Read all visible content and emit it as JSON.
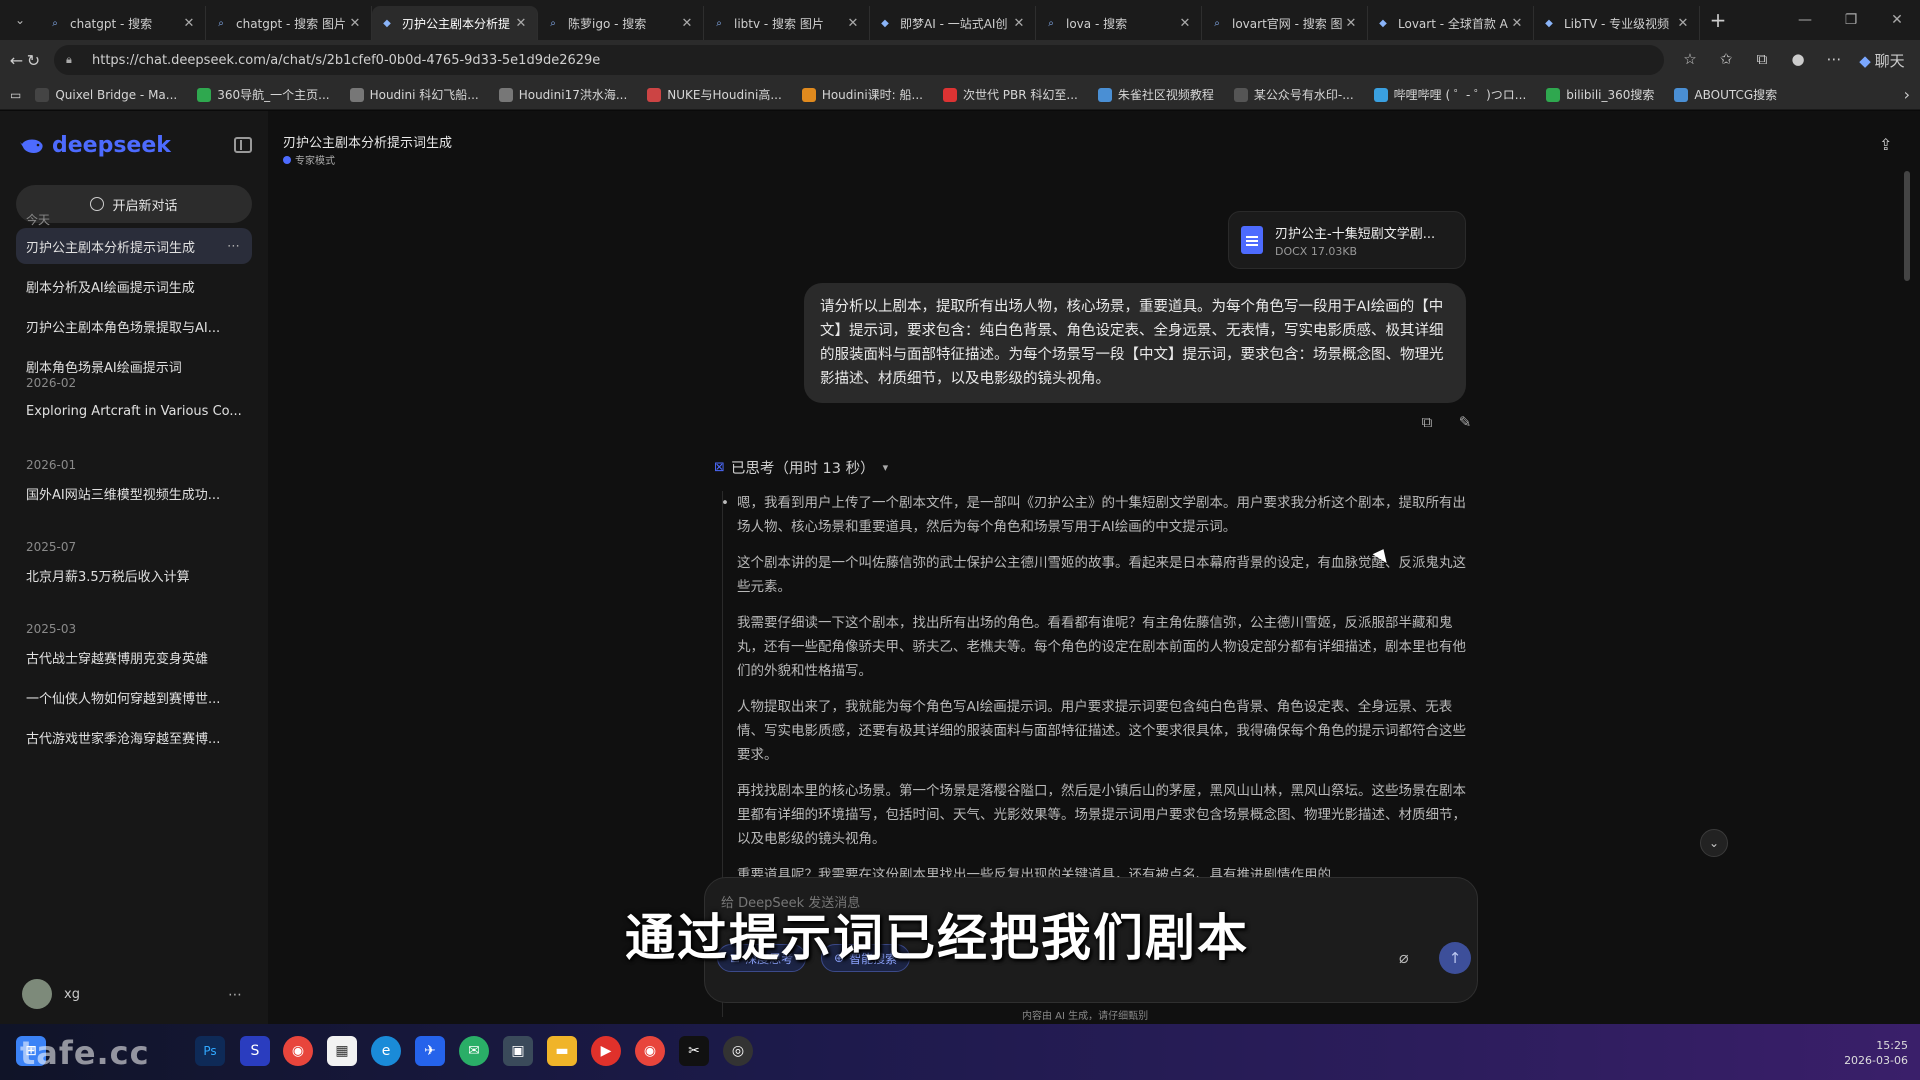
{
  "browser": {
    "tabs": [
      {
        "label": "chatgpt - 搜索",
        "icon": "search-icon"
      },
      {
        "label": "chatgpt - 搜索 图片",
        "icon": "search-icon"
      },
      {
        "label": "刃护公主剧本分析提",
        "icon": "deepseek-icon",
        "active": true
      },
      {
        "label": "陈萝igo - 搜索",
        "icon": "search-icon"
      },
      {
        "label": "libtv - 搜索 图片",
        "icon": "search-icon"
      },
      {
        "label": "即梦AI - 一站式AI创",
        "icon": "jimeng-icon"
      },
      {
        "label": "lova - 搜索",
        "icon": "search-icon"
      },
      {
        "label": "lovart官网 - 搜索 图片",
        "icon": "search-icon"
      },
      {
        "label": "Lovart - 全球首款 AI",
        "icon": "lovart-icon"
      },
      {
        "label": "LibTV - 专业级视频",
        "icon": "libtv-icon"
      }
    ],
    "url": "https://chat.deepseek.com/a/chat/s/2b1cfef0-0b0d-4765-9d33-5e1d9de2629e",
    "bookmarks": [
      {
        "label": "Quixel Bridge - Ma...",
        "color": "#444"
      },
      {
        "label": "360导航_一个主页...",
        "color": "#2fa84f"
      },
      {
        "label": "Houdini 科幻飞船...",
        "color": "#777"
      },
      {
        "label": "Houdini17洪水海...",
        "color": "#777"
      },
      {
        "label": "NUKE与Houdini高...",
        "color": "#c44"
      },
      {
        "label": "Houdini课时: 船...",
        "color": "#e08a1e"
      },
      {
        "label": "次世代 PBR 科幻至...",
        "color": "#d33"
      },
      {
        "label": "朱雀社区视频教程",
        "color": "#4a8fd4"
      },
      {
        "label": "某公众号有水印-...",
        "color": "#555"
      },
      {
        "label": "哔哩哔哩 ( ゜- ゜)つロ...",
        "color": "#3aa0e0"
      },
      {
        "label": "bilibili_360搜索",
        "color": "#2fa84f"
      },
      {
        "label": "ABOUTCG搜索",
        "color": "#4a8fd4"
      }
    ],
    "chat_button": "聊天"
  },
  "sidebar": {
    "logo": "deepseek",
    "new_chat": "开启新对话",
    "sections": [
      {
        "label": "今天",
        "items": [
          "刃护公主剧本分析提示词生成",
          "剧本分析及AI绘画提示词生成",
          "刃护公主剧本角色场景提取与AI...",
          "剧本角色场景AI绘画提示词"
        ]
      },
      {
        "label": "2026-02",
        "items": [
          "Exploring Artcraft in Various Co..."
        ]
      },
      {
        "label": "2026-01",
        "items": [
          "国外AI网站三维模型视频生成功..."
        ]
      },
      {
        "label": "2025-07",
        "items": [
          "北京月薪3.5万税后收入计算"
        ]
      },
      {
        "label": "2025-03",
        "items": [
          "古代战士穿越赛博朋克变身英雄",
          "一个仙侠人物如何穿越到赛博世...",
          "古代游戏世家季沧海穿越至赛博..."
        ]
      }
    ],
    "user_name": "xg"
  },
  "main": {
    "title": "刃护公主剧本分析提示词生成",
    "mode": "专家模式",
    "file": {
      "name": "刃护公主-十集短剧文学剧...",
      "meta": "DOCX 17.03KB"
    },
    "user_message": "请分析以上剧本，提取所有出场人物，核心场景，重要道具。为每个角色写一段用于AI绘画的【中文】提示词，要求包含：纯白色背景、角色设定表、全身远景、无表情，写实电影质感、极其详细的服装面料与面部特征描述。为每个场景写一段【中文】提示词，要求包含：场景概念图、物理光影描述、材质细节，以及电影级的镜头视角。",
    "thinking_header": "已思考（用时 13 秒）",
    "thinking": [
      "嗯，我看到用户上传了一个剧本文件，是一部叫《刃护公主》的十集短剧文学剧本。用户要求我分析这个剧本，提取所有出场人物、核心场景和重要道具，然后为每个角色和场景写用于AI绘画的中文提示词。",
      "这个剧本讲的是一个叫佐藤信弥的武士保护公主德川雪姬的故事。看起来是日本幕府背景的设定，有血脉觉醒、反派鬼丸这些元素。",
      "我需要仔细读一下这个剧本，找出所有出场的角色。看看都有谁呢？有主角佐藤信弥，公主德川雪姬，反派服部半藏和鬼丸，还有一些配角像骄夫甲、骄夫乙、老樵夫等。每个角色的设定在剧本前面的人物设定部分都有详细描述，剧本里也有他们的外貌和性格描写。",
      "人物提取出来了，我就能为每个角色写AI绘画提示词。用户要求提示词要包含纯白色背景、角色设定表、全身远景、无表情、写实电影质感，还要有极其详细的服装面料与面部特征描述。这个要求很具体，我得确保每个角色的提示词都符合这些要求。",
      "再找找剧本里的核心场景。第一个场景是落樱谷隘口，然后是小镇后山的茅屋，黑风山山林，黑风山祭坛。这些场景在剧本里都有详细的环境描写，包括时间、天气、光影效果等。场景提示词用户要求包含场景概念图、物理光影描述、材质细节，以及电影级的镜头视角。",
      "重要道具呢？我需要在这份剧本里找出一些反复出现的关键道具，还有被点名、具有推进剧情作用的..."
    ],
    "composer_placeholder": "给 DeepSeek 发送消息",
    "deep_think": "深度思考",
    "smart_search": "智能搜索",
    "disclaimer": "内容由 AI 生成，请仔细甄别"
  },
  "overlay": {
    "subtitle": "通过提示词已经把我们剧本",
    "watermark": "tafe.cc"
  },
  "taskbar": {
    "time": "15:25",
    "date": "2026-03-06"
  }
}
